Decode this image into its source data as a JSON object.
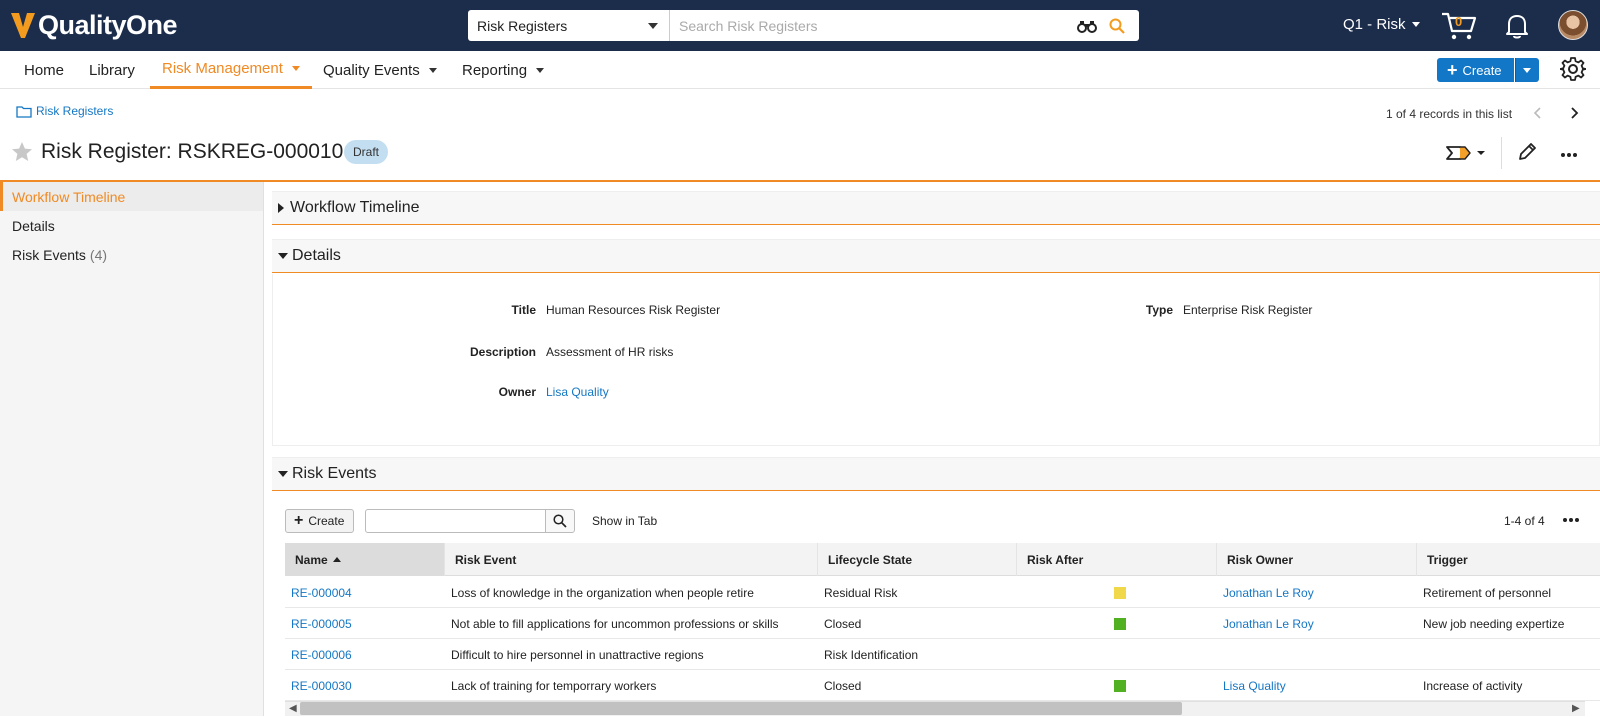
{
  "header": {
    "brand": "QualityOne",
    "search_scope": "Risk Registers",
    "search_placeholder": "Search Risk Registers",
    "vault": "Q1 - Risk",
    "cart_count": "0"
  },
  "nav": {
    "items": [
      {
        "label": "Home"
      },
      {
        "label": "Library"
      },
      {
        "label": "Risk Management"
      },
      {
        "label": "Quality Events"
      },
      {
        "label": "Reporting"
      }
    ],
    "create_label": "Create"
  },
  "breadcrumb": {
    "label": "Risk Registers"
  },
  "pager": {
    "records": "1 of 4 records in this list"
  },
  "record": {
    "title": "Risk Register: RSKREG-000010",
    "status": "Draft"
  },
  "sidebar": {
    "items": [
      {
        "label": "Workflow Timeline"
      },
      {
        "label": "Details"
      },
      {
        "label": "Risk Events",
        "count": "(4)"
      }
    ]
  },
  "sections": {
    "workflow": "Workflow Timeline",
    "details": "Details",
    "risk_events": "Risk Events"
  },
  "details": {
    "title_label": "Title",
    "title_value": "Human Resources Risk Register",
    "type_label": "Type",
    "type_value": "Enterprise Risk Register",
    "description_label": "Description",
    "description_value": "Assessment of HR risks",
    "owner_label": "Owner",
    "owner_value": "Lisa Quality"
  },
  "risk_events": {
    "create_label": "Create",
    "show_in_tab": "Show in Tab",
    "count": "1-4 of 4",
    "columns": [
      "Name",
      "Risk Event",
      "Lifecycle State",
      "Risk After",
      "Risk Owner",
      "Trigger"
    ],
    "rows": [
      {
        "name": "RE-000004",
        "event": "Loss of knowledge in the organization when people retire",
        "state": "Residual Risk",
        "risk_after": "#f0d84a",
        "owner": "Jonathan Le Roy",
        "trigger": "Retirement of personnel"
      },
      {
        "name": "RE-000005",
        "event": "Not able to fill applications for uncommon professions or skills",
        "state": "Closed",
        "risk_after": "#52b123",
        "owner": "Jonathan Le Roy",
        "trigger": "New job needing expertize"
      },
      {
        "name": "RE-000006",
        "event": "Difficult to hire personnel in unattractive regions",
        "state": "Risk Identification",
        "risk_after": "",
        "owner": "",
        "trigger": ""
      },
      {
        "name": "RE-000030",
        "event": "Lack of training for temporrary workers",
        "state": "Closed",
        "risk_after": "#52b123",
        "owner": "Lisa Quality",
        "trigger": "Increase of activity"
      }
    ]
  },
  "colors": {
    "accent": "#f08a24",
    "header_bg": "#1c2d4c",
    "link": "#1577c4",
    "primary": "#1277c7"
  }
}
